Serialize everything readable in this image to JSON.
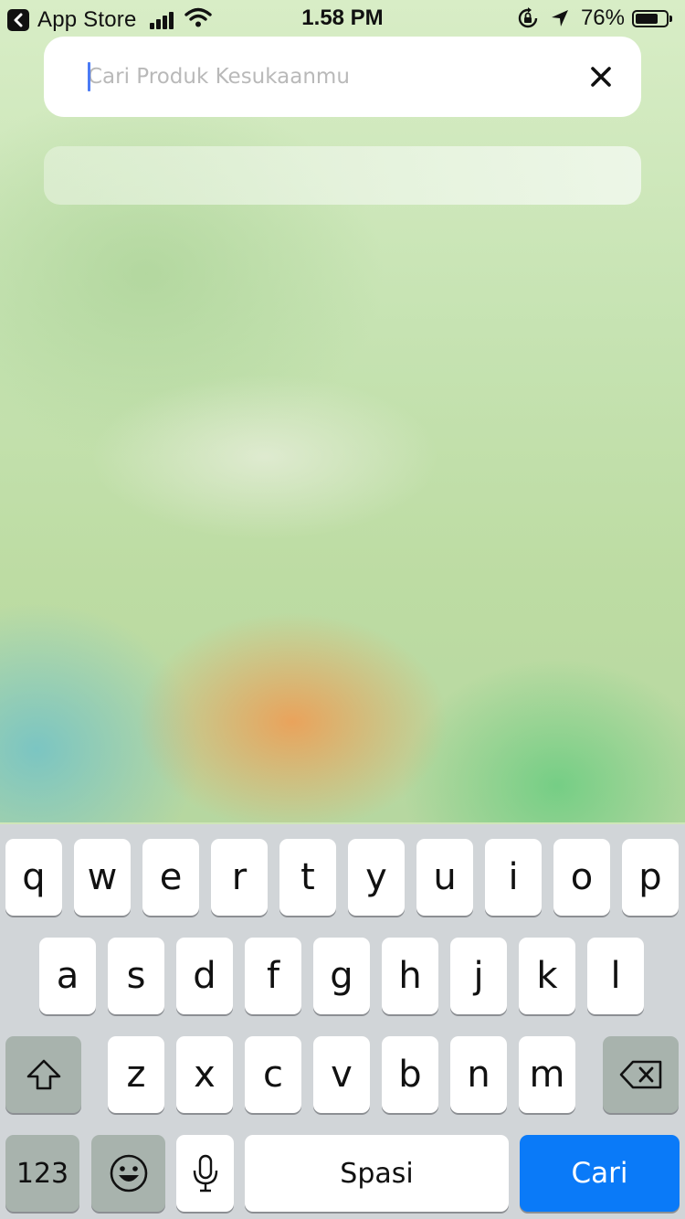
{
  "status_bar": {
    "app_back": "App Store",
    "time": "1.58 PM",
    "battery": "76%",
    "battery_level": 0.76
  },
  "search": {
    "placeholder": "Cari Produk Kesukaanmu",
    "value": "",
    "clear_icon": "close-icon"
  },
  "keyboard": {
    "row1": [
      "q",
      "w",
      "e",
      "r",
      "t",
      "y",
      "u",
      "i",
      "o",
      "p"
    ],
    "row2": [
      "a",
      "s",
      "d",
      "f",
      "g",
      "h",
      "j",
      "k",
      "l"
    ],
    "row3": [
      "z",
      "x",
      "c",
      "v",
      "b",
      "n",
      "m"
    ],
    "shift_icon": "shift-icon",
    "delete_icon": "backspace-icon",
    "numbers_label": "123",
    "emoji_icon": "emoji-icon",
    "mic_icon": "microphone-icon",
    "space_label": "Spasi",
    "action_label": "Cari"
  }
}
